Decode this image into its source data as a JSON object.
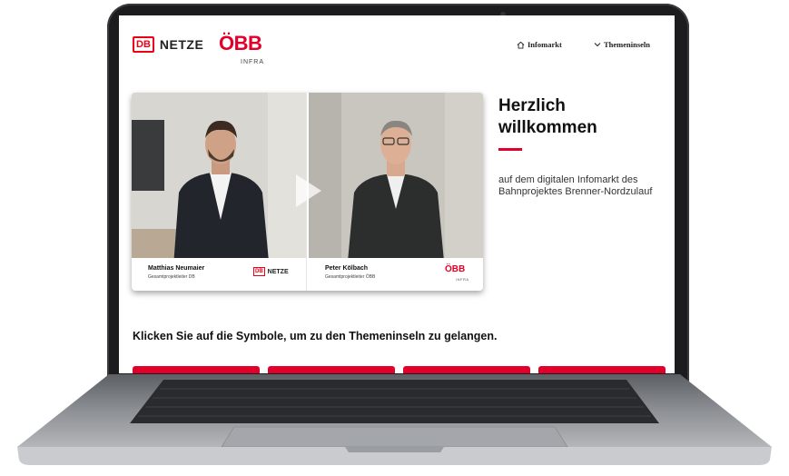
{
  "header": {
    "db_logo": "DB",
    "db_netze": "NETZE",
    "obb_logo": "ÖBB",
    "obb_infra": "INFRA"
  },
  "nav": {
    "infomarkt": "Infomarkt",
    "themeninseln": "Themeninseln"
  },
  "video": {
    "left": {
      "name": "Matthias Neumaier",
      "role": "Gesamtprojektleiter DB",
      "logo_db": "DB",
      "logo_netze": "NETZE"
    },
    "right": {
      "name": "Peter Kölbach",
      "role": "Gesamtprojektleiter ÖBB",
      "logo_obb": "ÖBB",
      "logo_infra": "INFRA"
    }
  },
  "welcome": {
    "title_line1": "Herzlich",
    "title_line2": "willkommen",
    "intro": "auf dem digitalen Infomarkt des Bahnprojektes Brenner-Nordzulauf"
  },
  "instruction": "Klicken Sie auf die Symbole, um zu den Themeninseln zu gelangen.",
  "colors": {
    "db_red": "#ec0016",
    "obb_red": "#e2002a",
    "laptop_frame": "#1c1c1e",
    "laptop_body": "#9ea1a5"
  },
  "icons": {
    "home": "home-icon",
    "chevron": "chevron-down-icon",
    "play": "play-icon"
  }
}
